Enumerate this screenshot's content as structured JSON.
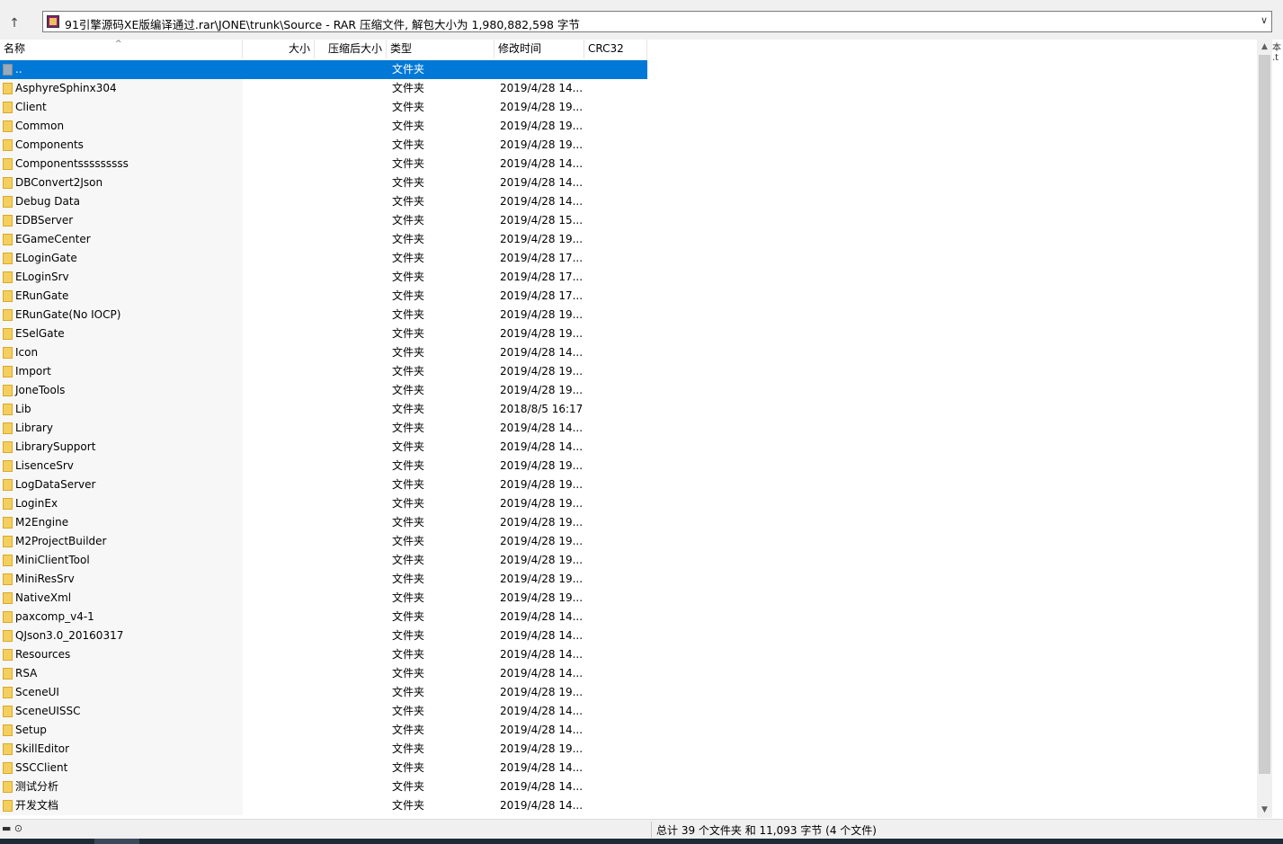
{
  "addressbar": {
    "up_label": "↑",
    "path": "91引擎源码XE版编译通过.rar\\JONE\\trunk\\Source - RAR 压缩文件, 解包大小为 1,980,882,598 字节",
    "dropdown_label": "∨"
  },
  "columns": {
    "name": "名称",
    "size": "大小",
    "packed": "压缩后大小",
    "type": "类型",
    "mtime": "修改时间",
    "crc": "CRC32",
    "sort_indicator": "^"
  },
  "rows": [
    {
      "name": "..",
      "type": "文件夹",
      "mtime": "",
      "selected": true
    },
    {
      "name": "AsphyreSphinx304",
      "type": "文件夹",
      "mtime": "2019/4/28 14..."
    },
    {
      "name": "Client",
      "type": "文件夹",
      "mtime": "2019/4/28 19..."
    },
    {
      "name": "Common",
      "type": "文件夹",
      "mtime": "2019/4/28 19..."
    },
    {
      "name": "Components",
      "type": "文件夹",
      "mtime": "2019/4/28 19..."
    },
    {
      "name": "Componentsssssssss",
      "type": "文件夹",
      "mtime": "2019/4/28 14..."
    },
    {
      "name": "DBConvert2Json",
      "type": "文件夹",
      "mtime": "2019/4/28 14..."
    },
    {
      "name": "Debug Data",
      "type": "文件夹",
      "mtime": "2019/4/28 14..."
    },
    {
      "name": "EDBServer",
      "type": "文件夹",
      "mtime": "2019/4/28 15..."
    },
    {
      "name": "EGameCenter",
      "type": "文件夹",
      "mtime": "2019/4/28 19..."
    },
    {
      "name": "ELoginGate",
      "type": "文件夹",
      "mtime": "2019/4/28 17..."
    },
    {
      "name": "ELoginSrv",
      "type": "文件夹",
      "mtime": "2019/4/28 17..."
    },
    {
      "name": "ERunGate",
      "type": "文件夹",
      "mtime": "2019/4/28 17..."
    },
    {
      "name": "ERunGate(No IOCP)",
      "type": "文件夹",
      "mtime": "2019/4/28 19..."
    },
    {
      "name": "ESelGate",
      "type": "文件夹",
      "mtime": "2019/4/28 19..."
    },
    {
      "name": "Icon",
      "type": "文件夹",
      "mtime": "2019/4/28 14..."
    },
    {
      "name": "Import",
      "type": "文件夹",
      "mtime": "2019/4/28 19..."
    },
    {
      "name": "JoneTools",
      "type": "文件夹",
      "mtime": "2019/4/28 19..."
    },
    {
      "name": "Lib",
      "type": "文件夹",
      "mtime": "2018/8/5 16:17"
    },
    {
      "name": "Library",
      "type": "文件夹",
      "mtime": "2019/4/28 14..."
    },
    {
      "name": "LibrarySupport",
      "type": "文件夹",
      "mtime": "2019/4/28 14..."
    },
    {
      "name": "LisenceSrv",
      "type": "文件夹",
      "mtime": "2019/4/28 19..."
    },
    {
      "name": "LogDataServer",
      "type": "文件夹",
      "mtime": "2019/4/28 19..."
    },
    {
      "name": "LoginEx",
      "type": "文件夹",
      "mtime": "2019/4/28 19..."
    },
    {
      "name": "M2Engine",
      "type": "文件夹",
      "mtime": "2019/4/28 19..."
    },
    {
      "name": "M2ProjectBuilder",
      "type": "文件夹",
      "mtime": "2019/4/28 19..."
    },
    {
      "name": "MiniClientTool",
      "type": "文件夹",
      "mtime": "2019/4/28 19..."
    },
    {
      "name": "MiniResSrv",
      "type": "文件夹",
      "mtime": "2019/4/28 19..."
    },
    {
      "name": "NativeXml",
      "type": "文件夹",
      "mtime": "2019/4/28 19..."
    },
    {
      "name": "paxcomp_v4-1",
      "type": "文件夹",
      "mtime": "2019/4/28 14..."
    },
    {
      "name": "QJson3.0_20160317",
      "type": "文件夹",
      "mtime": "2019/4/28 14..."
    },
    {
      "name": "Resources",
      "type": "文件夹",
      "mtime": "2019/4/28 14..."
    },
    {
      "name": "RSA",
      "type": "文件夹",
      "mtime": "2019/4/28 14..."
    },
    {
      "name": "SceneUI",
      "type": "文件夹",
      "mtime": "2019/4/28 19..."
    },
    {
      "name": "SceneUISSC",
      "type": "文件夹",
      "mtime": "2019/4/28 14..."
    },
    {
      "name": "Setup",
      "type": "文件夹",
      "mtime": "2019/4/28 14..."
    },
    {
      "name": "SkillEditor",
      "type": "文件夹",
      "mtime": "2019/4/28 19..."
    },
    {
      "name": "SSCClient",
      "type": "文件夹",
      "mtime": "2019/4/28 14..."
    },
    {
      "name": "测试分析",
      "type": "文件夹",
      "mtime": "2019/4/28 14..."
    },
    {
      "name": "开发文档",
      "type": "文件夹",
      "mtime": "2019/4/28 14..."
    }
  ],
  "statusbar": {
    "left_icons": "▬ ⊙",
    "summary": "总计 39 个文件夹 和 11,093 字节 (4 个文件)"
  },
  "scrollbar": {
    "up": "▲",
    "down": "▼"
  },
  "edge_text": "本 .t",
  "colors": {
    "selection": "#0078d7",
    "folder": "#f5cf5e",
    "chrome": "#f0f0f0"
  }
}
